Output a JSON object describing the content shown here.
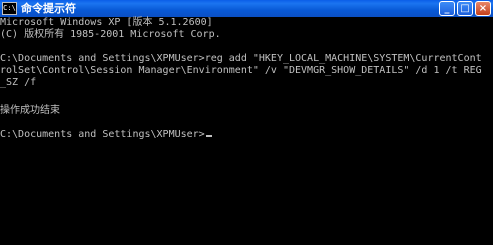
{
  "window": {
    "title": "命令提示符",
    "icon_text": "C:\\",
    "minimize_label": "_",
    "maximize_label": "□",
    "close_label": "×"
  },
  "console": {
    "lines": [
      "Microsoft Windows XP [版本 5.1.2600]",
      "(C) 版权所有 1985-2001 Microsoft Corp.",
      "",
      "C:\\Documents and Settings\\XPMUser>reg add \"HKEY_LOCAL_MACHINE\\SYSTEM\\CurrentCont",
      "rolSet\\Control\\Session Manager\\Environment\" /v \"DEVMGR_SHOW_DETAILS\" /d 1 /t REG",
      "_SZ /f",
      "",
      "操作成功结束",
      "",
      "C:\\Documents and Settings\\XPMUser>"
    ]
  }
}
